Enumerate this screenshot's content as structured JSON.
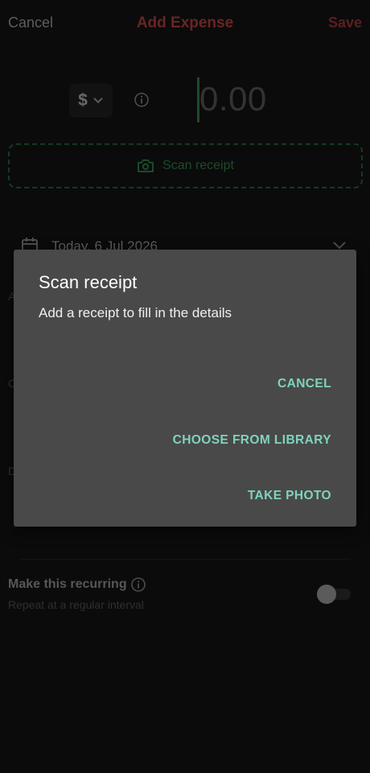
{
  "header": {
    "cancel_label": "Cancel",
    "title": "Add Expense",
    "save_label": "Save"
  },
  "amount": {
    "currency_symbol": "$",
    "placeholder": "0.00"
  },
  "scan": {
    "label": "Scan receipt"
  },
  "date": {
    "value": "Today, 6 Jul 2026"
  },
  "hidden_field_initials": [
    "A",
    "C",
    "D"
  ],
  "recurring": {
    "title": "Make this recurring",
    "subtitle": "Repeat at a regular interval",
    "enabled": false
  },
  "dialog": {
    "title": "Scan receipt",
    "message": "Add a receipt to fill in the details",
    "buttons": {
      "cancel": "CANCEL",
      "library": "CHOOSE FROM LIBRARY",
      "photo": "TAKE PHOTO"
    }
  },
  "colors": {
    "background": "#0b0b0b",
    "dialog_bg": "#494949",
    "dialog_button": "#7fd3bd",
    "accent_green": "#1d4a2a",
    "accent_red": "#6a2424"
  }
}
